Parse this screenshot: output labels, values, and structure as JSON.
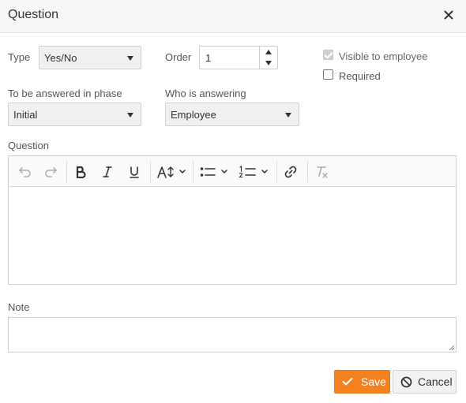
{
  "dialog": {
    "title": "Question"
  },
  "type": {
    "label": "Type",
    "value": "Yes/No"
  },
  "order": {
    "label": "Order",
    "value": "1"
  },
  "visible_to_employee": {
    "label": "Visible to employee",
    "checked": true,
    "disabled": true
  },
  "required": {
    "label": "Required",
    "checked": false
  },
  "phase": {
    "label": "To be answered in phase",
    "value": "Initial"
  },
  "who": {
    "label": "Who is answering",
    "value": "Employee"
  },
  "question": {
    "label": "Question",
    "toolbar": [
      "undo-icon",
      "redo-icon",
      "bold-icon",
      "italic-icon",
      "underline-icon",
      "font-size-icon",
      "bullet-list-icon",
      "numbered-list-icon",
      "link-icon",
      "clear-format-icon"
    ]
  },
  "note": {
    "label": "Note"
  },
  "buttons": {
    "save": "Save",
    "cancel": "Cancel"
  },
  "colors": {
    "accent": "#f48120",
    "header_bg": "#f6f6f6",
    "field_bg": "#f0f0f0"
  }
}
